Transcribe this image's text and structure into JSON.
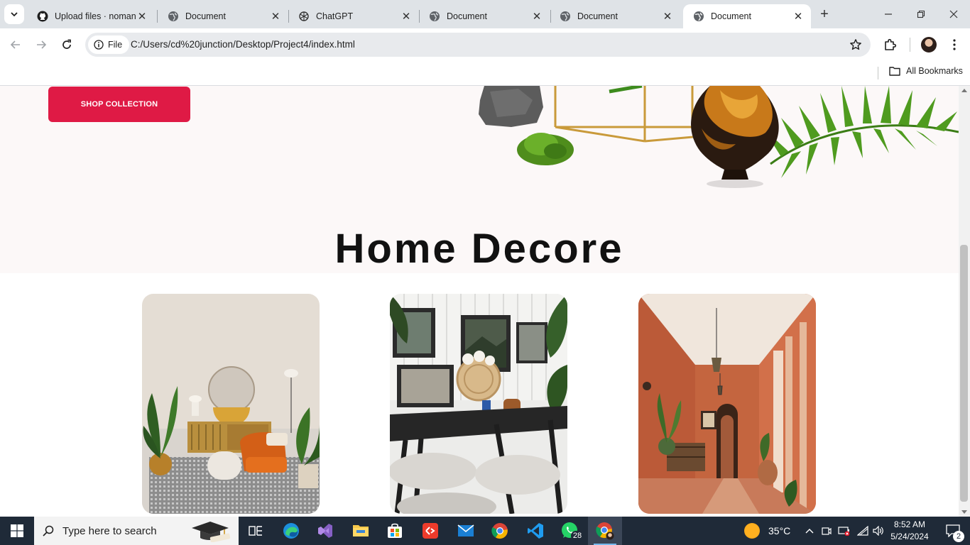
{
  "browser": {
    "tabs": [
      {
        "title": "Upload files · nomanu",
        "favicon": "github-icon",
        "active": false
      },
      {
        "title": "Document",
        "favicon": "globe-icon",
        "active": false
      },
      {
        "title": "ChatGPT",
        "favicon": "chatgpt-icon",
        "active": false
      },
      {
        "title": "Document",
        "favicon": "globe-icon",
        "active": false
      },
      {
        "title": "Document",
        "favicon": "globe-icon",
        "active": false
      },
      {
        "title": "Document",
        "favicon": "globe-icon",
        "active": true
      }
    ],
    "address_bar": {
      "scheme_chip": "File",
      "url": "C:/Users/cd%20junction/Desktop/Project4/index.html"
    },
    "bookmarks": {
      "all_bookmarks_label": "All Bookmarks"
    }
  },
  "page": {
    "hero": {
      "cta_label": "SHOP COLLECTION"
    },
    "section_title": "Home Decore",
    "cards": [
      {
        "image": "living-room-photo"
      },
      {
        "image": "dining-table-photo"
      },
      {
        "image": "terracotta-hallway-photo"
      }
    ],
    "colors": {
      "cta_background": "#df1a45",
      "hero_background": "#fcf8f8",
      "heading": "#111111"
    }
  },
  "taskbar": {
    "search_placeholder": "Type here to search",
    "pinned_apps": [
      "task-view",
      "edge",
      "visual-studio",
      "file-explorer",
      "microsoft-store",
      "git-app",
      "mail",
      "chrome",
      "vscode",
      "whatsapp",
      "chrome-profile"
    ],
    "whatsapp_badge": "28",
    "weather": {
      "temperature": "35°C"
    },
    "clock": {
      "time": "8:52 AM",
      "date": "5/24/2024"
    },
    "notifications_count": "2"
  }
}
